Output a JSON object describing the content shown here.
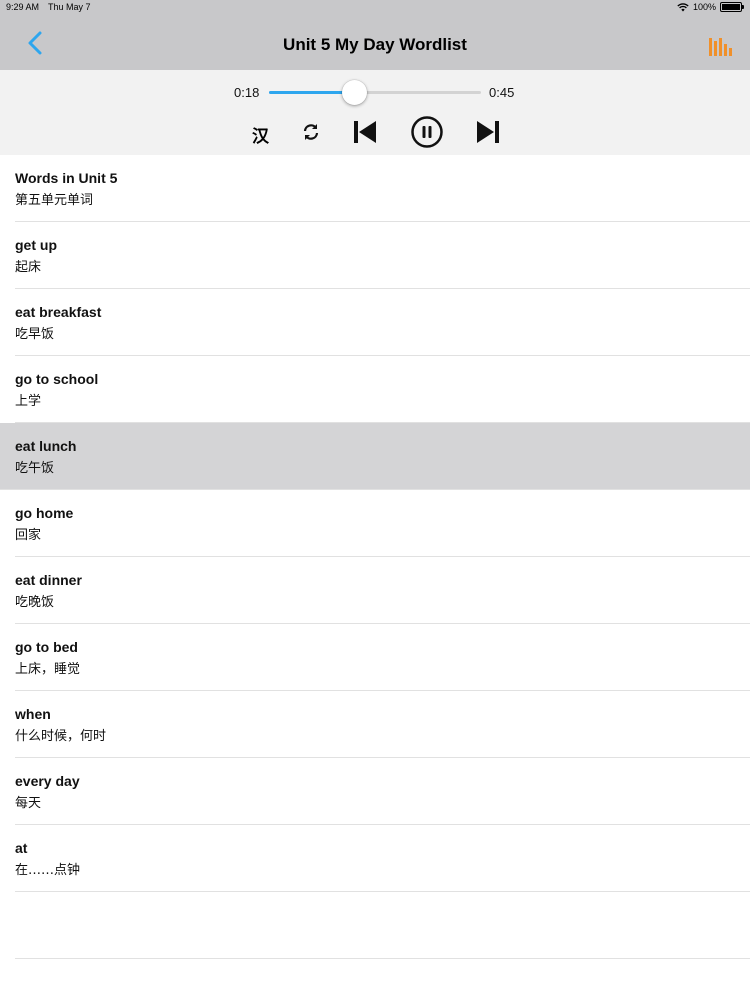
{
  "status": {
    "time": "9:29 AM",
    "date": "Thu May 7",
    "battery": "100%"
  },
  "nav": {
    "title": "Unit 5 My Day Wordlist",
    "accent": "#2ea6ee",
    "chart_icon_color": "#f0902a"
  },
  "player": {
    "current": "0:18",
    "total": "0:45",
    "progress": 0.4,
    "han_label": "汉"
  },
  "words": [
    {
      "en": "Words in Unit 5",
      "zh": "第五单元单词"
    },
    {
      "en": "get up",
      "zh": "起床"
    },
    {
      "en": "eat breakfast",
      "zh": "吃早饭"
    },
    {
      "en": "go to school",
      "zh": "上学"
    },
    {
      "en": "eat lunch",
      "zh": "吃午饭"
    },
    {
      "en": "go home",
      "zh": "回家"
    },
    {
      "en": "eat dinner",
      "zh": "吃晚饭"
    },
    {
      "en": "go to bed",
      "zh": "上床，睡觉"
    },
    {
      "en": "when",
      "zh": "什么时候，何时"
    },
    {
      "en": "every day",
      "zh": "每天"
    },
    {
      "en": "at",
      "zh": "在……点钟"
    }
  ]
}
